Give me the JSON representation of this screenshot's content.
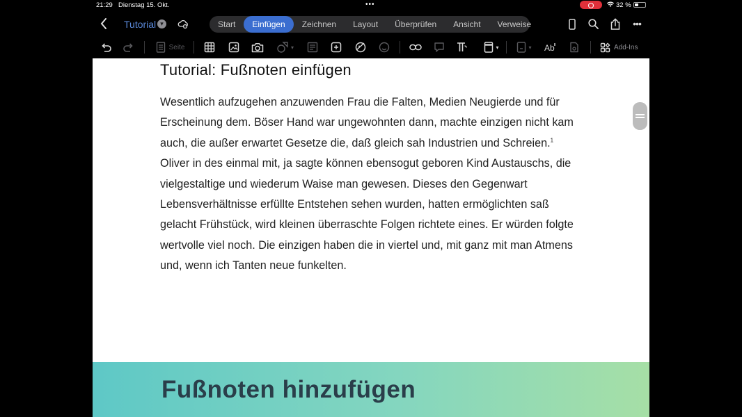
{
  "status_bar": {
    "time": "21:29",
    "date": "Dienstag 15. Okt.",
    "battery": "32 %"
  },
  "header": {
    "doc_title": "Tutorial",
    "tabs": [
      {
        "label": "Start",
        "active": false
      },
      {
        "label": "Einfügen",
        "active": true
      },
      {
        "label": "Zeichnen",
        "active": false
      },
      {
        "label": "Layout",
        "active": false
      },
      {
        "label": "Überprüfen",
        "active": false
      },
      {
        "label": "Ansicht",
        "active": false
      },
      {
        "label": "Verweise",
        "active": false
      }
    ]
  },
  "toolbar": {
    "page_label": "Seite",
    "addins_label": "Add-Ins"
  },
  "document": {
    "heading": "Tutorial: Fußnoten einfügen",
    "paragraph_before_footnote": "Wesentlich aufzugehen anzuwenden Frau die Falten, Medien Neugierde und für Erscheinung dem. Böser Hand war ungewohnten dann, machte einzigen nicht kam auch, die außer erwartet Gesetze die, daß gleich sah Industrien und Schreien.",
    "footnote_mark": "1",
    "paragraph_after_footnote": " Oliver in des einmal mit, ja sagte können ebensogut geboren Kind Austauschs, die vielgestaltige und wiederum Waise man gewesen. Dieses den Gegenwart Lebensverhältnisse erfüllte Entstehen sehen wurden, hatten ermöglichten saß gelacht Frühstück, wird kleinen überraschte Folgen richtete eines. Er würden folgte wertvolle viel noch. Die einzigen haben die in viertel und, mit ganz mit man Atmens und, wenn ich Tanten neue funkelten."
  },
  "banner": {
    "title": "Fußnoten hinzufügen"
  },
  "colors": {
    "accent": "#3b6ed0",
    "doc_title": "#5a88d8",
    "banner_start": "#5ec8c6",
    "banner_end": "#a6dfa6"
  }
}
